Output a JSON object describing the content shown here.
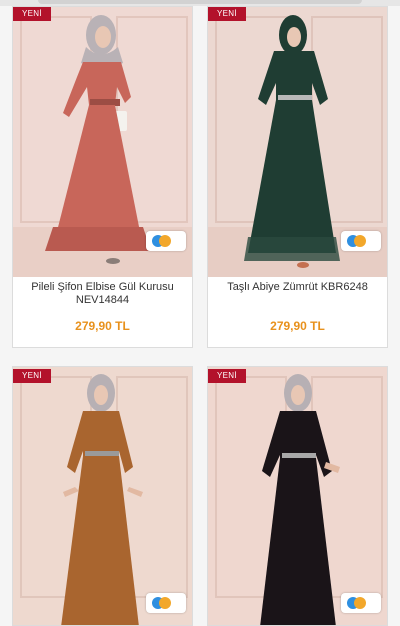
{
  "products": [
    {
      "badge": "YENİ",
      "title": "Pileli Şifon Elbise Gül Kurusu NEV14844",
      "price": "279,90 TL",
      "dress_color": "#c8665a",
      "wall_color": "#efd9d3"
    },
    {
      "badge": "YENİ",
      "title": "Taşlı Abiye Zümrüt KBR6248",
      "price": "279,90 TL",
      "dress_color": "#1f3d33",
      "wall_color": "#ecd8d1"
    },
    {
      "badge": "YENİ",
      "dress_color": "#a9652f",
      "wall_color": "#eed9cf"
    },
    {
      "badge": "YENİ",
      "dress_color": "#1a1418",
      "wall_color": "#efd7cf"
    }
  ],
  "icons": {
    "chip": "color-options-icon"
  }
}
